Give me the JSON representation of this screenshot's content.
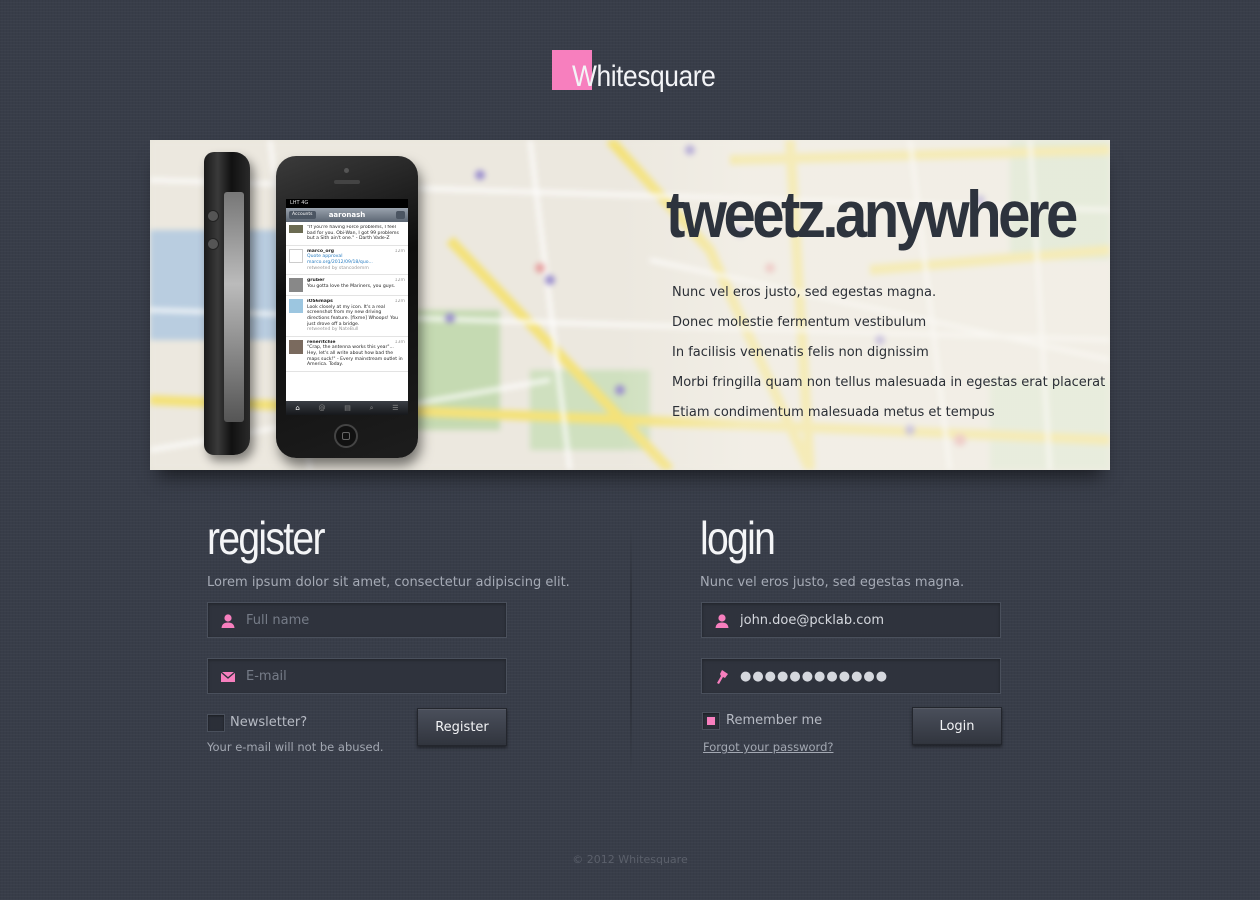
{
  "logo": {
    "text": "Whitesquare",
    "accent": "#f77fbe"
  },
  "banner": {
    "title": "tweetz.anywhere",
    "features": [
      "Nunc vel eros justo, sed egestas magna.",
      "Donec molestie fermentum vestibulum",
      "In facilisis venenatis felis non dignissim",
      "Morbi fringilla quam non tellus malesuada in egestas erat placerat",
      "Etiam condimentum malesuada metus et tempus"
    ],
    "phone": {
      "status": "LHT 4G",
      "nav_title": "aaronash",
      "nav_back": "Accounts",
      "tweets": [
        {
          "user": "",
          "time": "",
          "text": "\"If you're having Force problems, I feel bad for you. Obi-Wan, I got 99 problems but a Sith ain't one.\" - Darth Vade-Z",
          "meta": ""
        },
        {
          "user": "marco_org",
          "time": "12m",
          "text": "Quote approval marco.org/2012/09/18/quo...",
          "meta": "retweeted by stancodemm"
        },
        {
          "user": "gruber",
          "time": "12m",
          "text": "You gotta love the Mariners, you guys.",
          "meta": ""
        },
        {
          "user": "iOS6maps",
          "time": "12m",
          "text": "Look closely at my icon. It's a real screenshot from my new driving directions feature. [fixme] Whoops! You just drove off a bridge.",
          "meta": "retweeted by NateBull"
        },
        {
          "user": "reneritchie",
          "time": "13m",
          "text": "\"Crap, the antenna works this year\"... Hey, let's all write about how bad the maps suck!\" - Every mainstream outlet in America. Today.",
          "meta": ""
        }
      ]
    }
  },
  "register": {
    "heading": "register",
    "subtitle": "Lorem ipsum dolor sit amet, consectetur adipiscing elit.",
    "name_placeholder": "Full name",
    "email_placeholder": "E-mail",
    "newsletter_label": "Newsletter?",
    "newsletter_checked": false,
    "note": "Your e-mail will not be abused.",
    "button": "Register"
  },
  "login": {
    "heading": "login",
    "subtitle": "Nunc vel eros justo, sed egestas magna.",
    "email_value": "john.doe@pcklab.com",
    "password_value": "●●●●●●●●●●●●",
    "remember_label": "Remember me",
    "remember_checked": true,
    "forgot": "Forgot your password?",
    "button": "Login"
  },
  "footer": "© 2012 Whitesquare"
}
